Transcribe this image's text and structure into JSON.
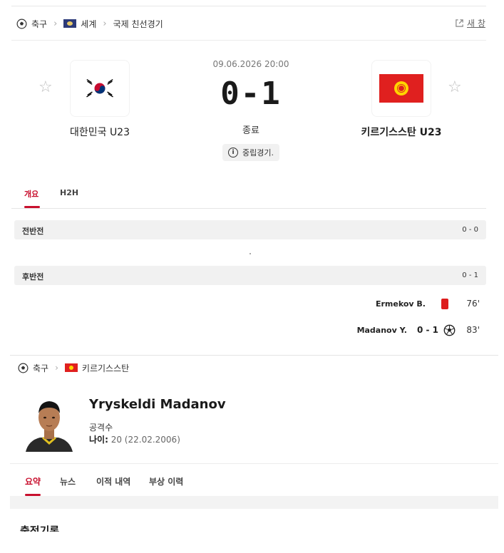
{
  "breadcrumb": {
    "sport": "축구",
    "region": "세계",
    "competition": "국제 친선경기",
    "new_window": "새 창"
  },
  "match": {
    "datetime": "09.06.2026 20:00",
    "score": "0-1",
    "status": "종료",
    "neutral_label": "중립경기.",
    "home": {
      "name": "대한민국 U23"
    },
    "away": {
      "name": "키르기스스탄 U23"
    }
  },
  "tabs": [
    {
      "label": "개요"
    },
    {
      "label": "H2H"
    }
  ],
  "periods": [
    {
      "label": "전반전",
      "score": "0 - 0"
    },
    {
      "label": "후반전",
      "score": "0 - 1"
    }
  ],
  "events": [
    {
      "player": "Ermekov B.",
      "type": "red-card",
      "minute": "76'"
    },
    {
      "player": "Madanov Y.",
      "type": "goal",
      "score": "0 - 1",
      "minute": "83'"
    }
  ],
  "player_page": {
    "breadcrumb": {
      "sport": "축구",
      "country": "키르기스스탄"
    },
    "name": "Yryskeldi Madanov",
    "position": "공격수",
    "age_label": "나이:",
    "age_value": "20 (22.02.2006)",
    "tabs": [
      {
        "label": "요약"
      },
      {
        "label": "뉴스"
      },
      {
        "label": "이적 내역"
      },
      {
        "label": "부상 이력"
      }
    ],
    "section_title": "출전기록"
  },
  "colors": {
    "accent": "#c8102e",
    "red_card": "#dd1c1c",
    "kg_red": "#e0201f",
    "kg_yellow": "#ffd500"
  },
  "icons": [
    "soccer-ball-icon",
    "chevron-right-icon",
    "external-link-icon",
    "star-icon",
    "info-icon",
    "red-card-icon"
  ]
}
